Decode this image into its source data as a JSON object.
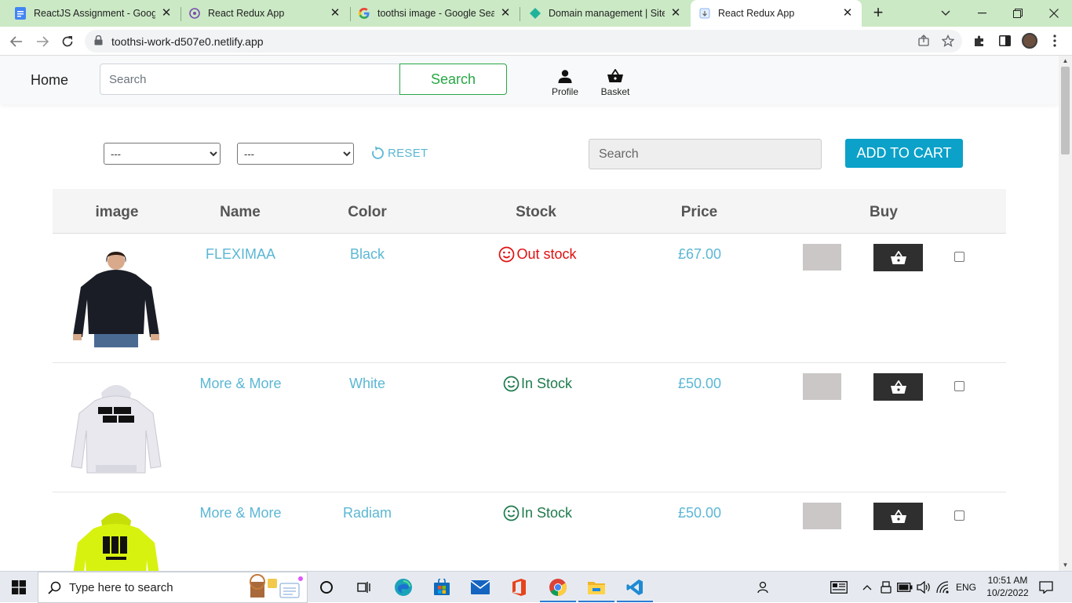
{
  "browser": {
    "tabs": [
      {
        "title": "ReactJS Assignment - Google Docs",
        "icon": "docs-icon",
        "active": false
      },
      {
        "title": "React Redux App",
        "icon": "redux-icon",
        "active": false
      },
      {
        "title": "toothsi image - Google Search",
        "icon": "google-icon",
        "active": false
      },
      {
        "title": "Domain management | Site settings",
        "icon": "netlify-icon",
        "active": false
      },
      {
        "title": "React Redux App",
        "icon": "page-icon",
        "active": true
      }
    ],
    "url": "toothsi-work-d507e0.netlify.app"
  },
  "app": {
    "brand": "Home",
    "search_placeholder": "Search",
    "search_button": "Search",
    "profile_label": "Profile",
    "basket_label": "Basket"
  },
  "filters": {
    "select1_value": "---",
    "select2_value": "---",
    "reset_label": "RESET",
    "search_placeholder": "Search",
    "add_to_cart_label": "ADD TO CART"
  },
  "table": {
    "headers": [
      "image",
      "Name",
      "Color",
      "Stock",
      "Price",
      "Buy"
    ],
    "rows": [
      {
        "name": "FLEXIMAA",
        "color": "Black",
        "stock": "Out stock",
        "in_stock": false,
        "price": "£67.00",
        "image_color": "#1b1d26"
      },
      {
        "name": "More & More",
        "color": "White",
        "stock": "In Stock",
        "in_stock": true,
        "price": "£50.00",
        "image_color": "#e8e8ee"
      },
      {
        "name": "More & More",
        "color": "Radiam",
        "stock": "In Stock",
        "in_stock": true,
        "price": "£50.00",
        "image_color": "#d7f20f"
      }
    ]
  },
  "taskbar": {
    "search_placeholder": "Type here to search",
    "language": "ENG",
    "time": "10:51 AM",
    "date": "10/2/2022"
  },
  "colors": {
    "accent_teal": "#5bb7d4",
    "out_of_stock": "#e01010",
    "in_stock": "#1f7a4d",
    "add_to_cart": "#0ba1c9",
    "search_green": "#28a745"
  }
}
